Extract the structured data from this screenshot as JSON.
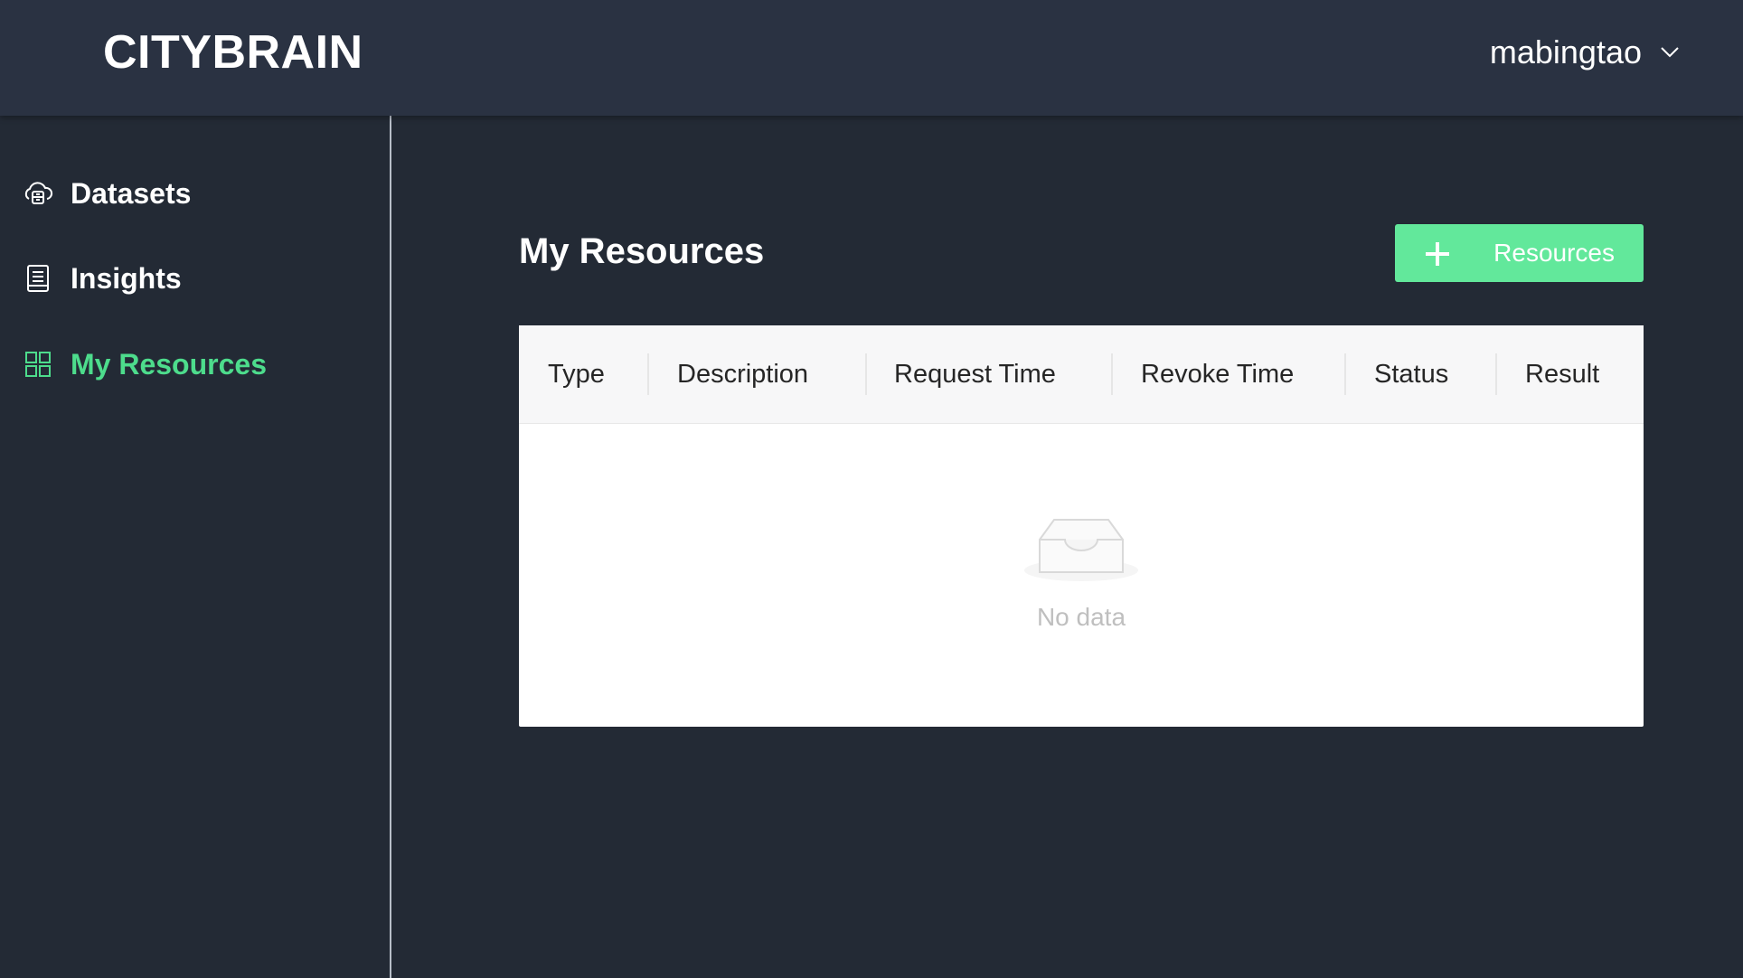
{
  "header": {
    "logo": "CITYBRAIN",
    "user_name": "mabingtao",
    "user_menu_icon": "chevron-down-icon"
  },
  "sidebar": {
    "items": [
      {
        "label": "Datasets",
        "icon": "cloud-database-icon",
        "active": false
      },
      {
        "label": "Insights",
        "icon": "report-document-icon",
        "active": false
      },
      {
        "label": "My Resources",
        "icon": "grid-apps-icon",
        "active": true
      }
    ]
  },
  "main": {
    "title": "My Resources",
    "add_button": {
      "label": "Resources",
      "icon": "plus-icon"
    },
    "table": {
      "columns": [
        "Type",
        "Description",
        "Request Time",
        "Revoke Time",
        "Status",
        "Result"
      ],
      "rows": [],
      "empty_text": "No data",
      "empty_icon": "empty-inbox-icon"
    }
  },
  "colors": {
    "background": "#232a35",
    "header": "#2a3242",
    "accent": "#4ddc8c",
    "button": "#62e89b"
  }
}
